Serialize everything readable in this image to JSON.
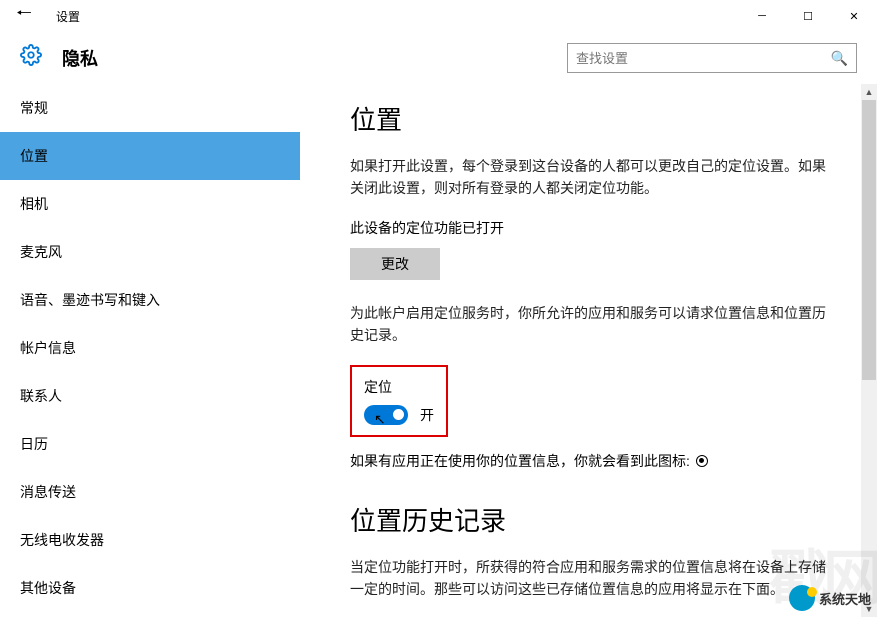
{
  "titlebar": {
    "title": "设置"
  },
  "header": {
    "title": "隐私"
  },
  "search": {
    "placeholder": "查找设置"
  },
  "sidebar": {
    "items": [
      {
        "label": "常规"
      },
      {
        "label": "位置"
      },
      {
        "label": "相机"
      },
      {
        "label": "麦克风"
      },
      {
        "label": "语音、墨迹书写和键入"
      },
      {
        "label": "帐户信息"
      },
      {
        "label": "联系人"
      },
      {
        "label": "日历"
      },
      {
        "label": "消息传送"
      },
      {
        "label": "无线电收发器"
      },
      {
        "label": "其他设备"
      }
    ],
    "selected_index": 1
  },
  "content": {
    "section1_title": "位置",
    "desc1": "如果打开此设置，每个登录到这台设备的人都可以更改自己的定位设置。如果关闭此设置，则对所有登录的人都关闭定位功能。",
    "status_text": "此设备的定位功能已打开",
    "change_btn": "更改",
    "desc2": "为此帐户启用定位服务时，你所允许的应用和服务可以请求位置信息和位置历史记录。",
    "toggle_label": "定位",
    "toggle_state": "开",
    "indicator_text": "如果有应用正在使用你的位置信息，你就会看到此图标:",
    "section2_title": "位置历史记录",
    "desc3": "当定位功能打开时，所获得的符合应用和服务需求的位置信息将在设备上存储一定的时间。那些可以访问这些已存储位置信息的应用将显示在下面。"
  },
  "watermark": {
    "text": "系统天地"
  }
}
